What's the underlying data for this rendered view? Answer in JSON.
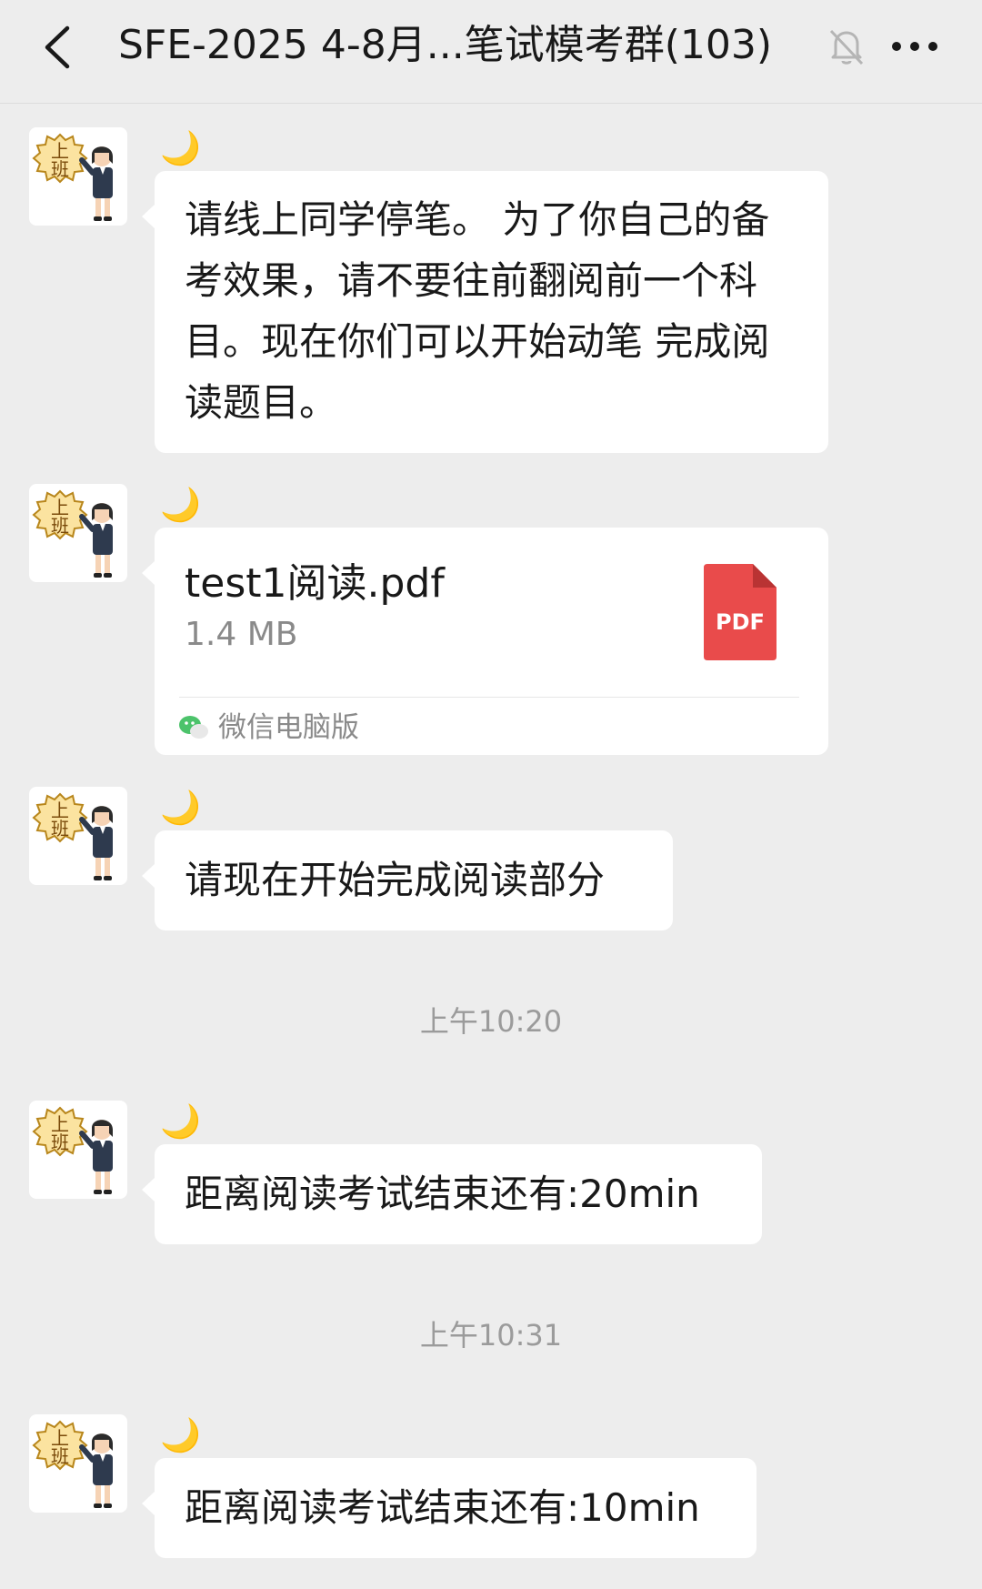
{
  "header": {
    "title": "SFE-2025 4-8月...笔试模考群(103)"
  },
  "sender": {
    "nickname": "🌙",
    "avatar_text_top": "上",
    "avatar_text_bottom": "班"
  },
  "messages": [
    {
      "type": "text",
      "text": "请线上同学停笔。 为了你自己的备考效果，请不要往前翻阅前一个科目。现在你们可以开始动笔 完成阅读题目。"
    },
    {
      "type": "file",
      "file_name": "test1阅读.pdf",
      "file_size": "1.4 MB",
      "file_icon_label": "PDF",
      "source": "微信电脑版"
    },
    {
      "type": "text",
      "text": "请现在开始完成阅读部分"
    },
    {
      "type": "time",
      "text": "上午10:20"
    },
    {
      "type": "text",
      "text": "距离阅读考试结束还有:20min"
    },
    {
      "type": "time",
      "text": "上午10:31"
    },
    {
      "type": "text",
      "text": "距离阅读考试结束还有:10min"
    }
  ],
  "colors": {
    "background": "#ededed",
    "bubble": "#ffffff",
    "pdf_red": "#e94b4b",
    "timestamp": "#9b9b9b"
  }
}
